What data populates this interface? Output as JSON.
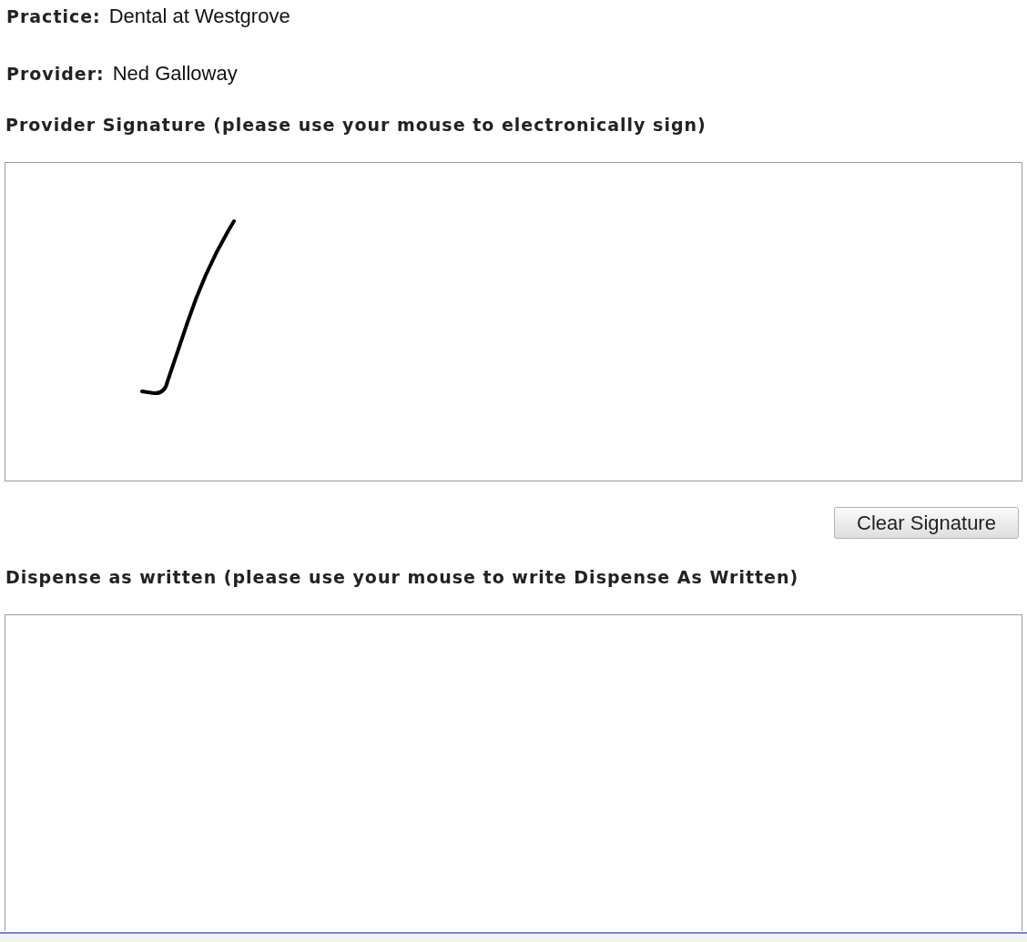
{
  "fields": [
    {
      "label": "Practice:",
      "value": "Dental at Westgrove"
    },
    {
      "label": "Provider:",
      "value": "Ned Galloway"
    }
  ],
  "signature_pads": [
    {
      "heading": "Provider Signature (please use your mouse to electronically sign)",
      "signed": true,
      "button": "Clear Signature"
    },
    {
      "heading": "Dispense as written (please use your mouse to write Dispense As Written)",
      "signed": false
    }
  ]
}
